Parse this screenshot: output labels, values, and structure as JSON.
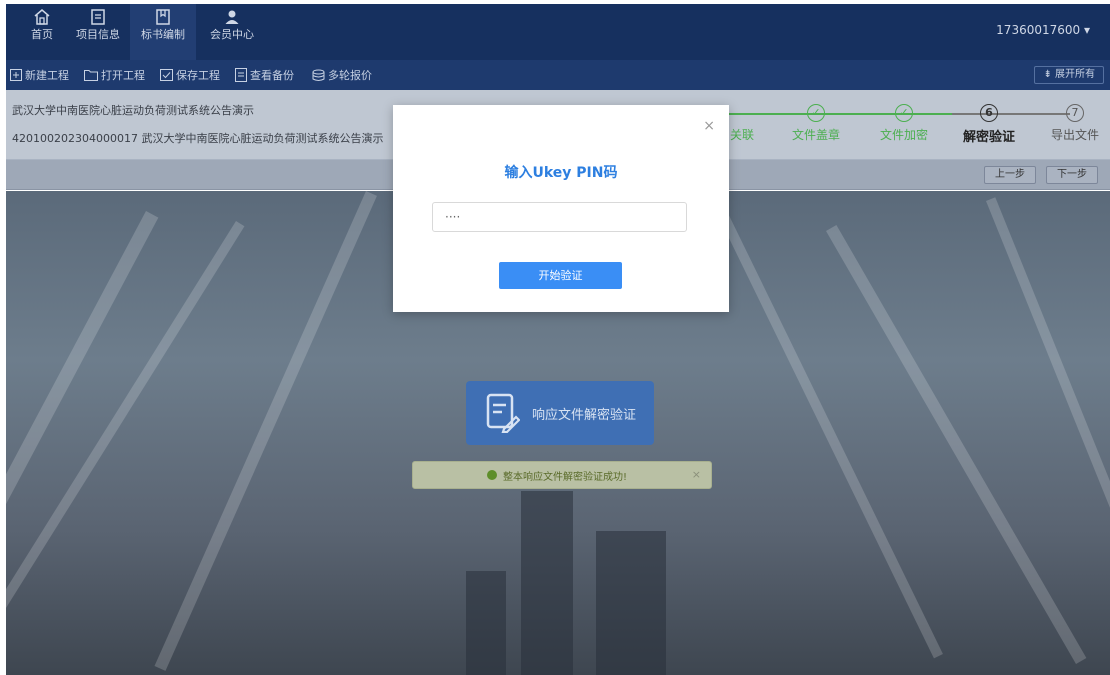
{
  "nav": {
    "items": [
      {
        "label": "首页",
        "icon": "home-icon"
      },
      {
        "label": "项目信息",
        "icon": "document-icon"
      },
      {
        "label": "标书编制",
        "icon": "bookmark-icon"
      },
      {
        "label": "会员中心",
        "icon": "user-icon"
      }
    ],
    "user": "17360017600 ▾"
  },
  "toolbar": {
    "buttons": [
      {
        "label": "新建工程",
        "icon": "plus-box-icon"
      },
      {
        "label": "打开工程",
        "icon": "folder-icon"
      },
      {
        "label": "保存工程",
        "icon": "check-box-icon"
      },
      {
        "label": "查看备份",
        "icon": "file-list-icon"
      },
      {
        "label": "多轮报价",
        "icon": "database-icon"
      }
    ],
    "expand": "⇟ 展开所有"
  },
  "project": {
    "name": "武汉大学中南医院心脏运动负荷测试系统公告演示",
    "code_name": "420100202304000017 武汉大学中南医院心脏运动负荷测试系统公告演示"
  },
  "steps": [
    {
      "num": "✓",
      "label": "关联",
      "state": "done"
    },
    {
      "num": "✓",
      "label": "文件盖章",
      "state": "done"
    },
    {
      "num": "✓",
      "label": "文件加密",
      "state": "done"
    },
    {
      "num": "6",
      "label": "解密验证",
      "state": "current"
    },
    {
      "num": "7",
      "label": "导出文件",
      "state": "todo"
    }
  ],
  "step_nav": {
    "prev": "上一步",
    "next": "下一步"
  },
  "verify_card": {
    "label": "响应文件解密验证"
  },
  "toast": {
    "text": "整本响应文件解密验证成功!",
    "close": "×"
  },
  "modal": {
    "title": "输入Ukey PIN码",
    "pin_value": "····",
    "start_button": "开始验证",
    "close": "×"
  },
  "colors": {
    "nav_bg": "#16305f",
    "accent_blue": "#3a8ef5",
    "step_done": "#4caf50"
  }
}
